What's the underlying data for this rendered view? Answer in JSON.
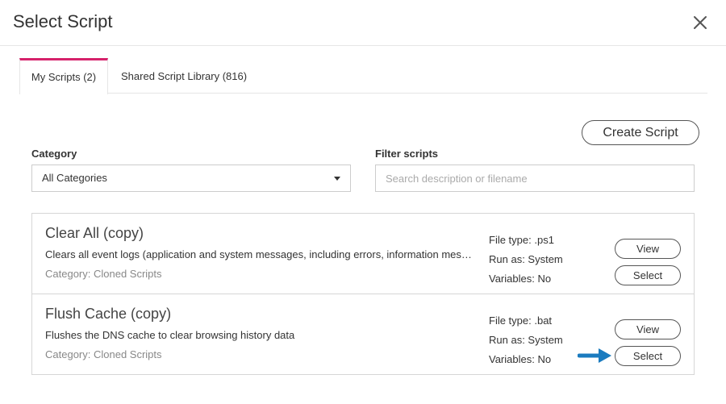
{
  "dialog": {
    "title": "Select Script"
  },
  "tabs": [
    {
      "label": "My Scripts (2)"
    },
    {
      "label": "Shared Script Library (816)"
    }
  ],
  "toolbar": {
    "create_label": "Create Script"
  },
  "filters": {
    "category_label": "Category",
    "category_value": "All Categories",
    "filter_label": "Filter scripts",
    "filter_placeholder": "Search description or filename",
    "filter_value": ""
  },
  "scripts": [
    {
      "name": "Clear All (copy)",
      "description": "Clears all event logs (application and system messages, including errors, information messages, and warnings)",
      "category": "Category: Cloned Scripts",
      "file_type": "File type: .ps1",
      "run_as": "Run as: System",
      "variables": "Variables: No",
      "view_label": "View",
      "select_label": "Select"
    },
    {
      "name": "Flush Cache (copy)",
      "description": "Flushes the DNS cache to clear browsing history data",
      "category": "Category: Cloned Scripts",
      "file_type": "File type: .bat",
      "run_as": "Run as: System",
      "variables": "Variables: No",
      "view_label": "View",
      "select_label": "Select"
    }
  ],
  "colors": {
    "accent": "#d6226b",
    "arrow": "#1a7bbf"
  },
  "icons": {
    "close": "close-icon",
    "dropdown": "chevron-down-icon",
    "pointer": "arrow-right-icon"
  }
}
